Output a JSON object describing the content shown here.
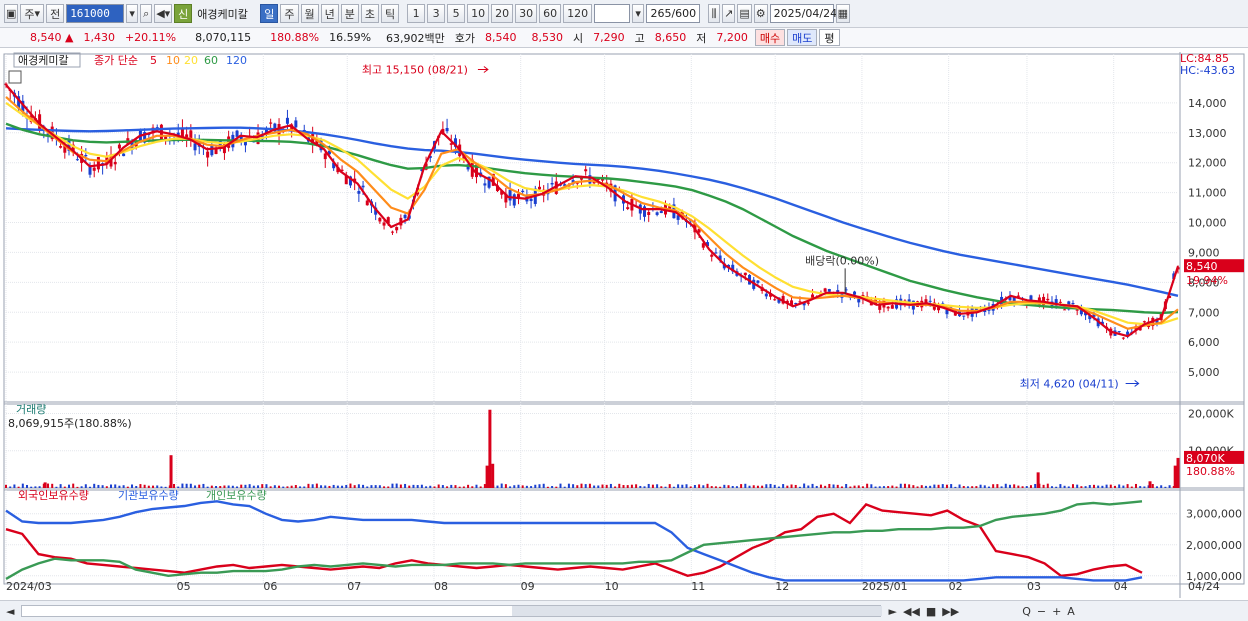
{
  "toolbar": {
    "period_label": "주",
    "prev_label": "전",
    "code": "161000",
    "badge": "신",
    "stock_name": "애경케미칼",
    "periods": [
      "일",
      "주",
      "월",
      "년",
      "분",
      "초",
      "틱"
    ],
    "active_period": "일",
    "counts": [
      "1",
      "3",
      "5",
      "10",
      "20",
      "30",
      "60",
      "120"
    ],
    "bar_count": "265",
    "bar_total": "/600",
    "date": "2025/04/24"
  },
  "quote": {
    "price": "8,540",
    "arrow": "▲",
    "change": "1,430",
    "change_pct": "+20.11%",
    "volume": "8,070,115",
    "volume_ratio": "180.88%",
    "turnover": "16.59%",
    "amount": "63,902백만",
    "hoga_label": "호가",
    "ask": "8,540",
    "bid": "8,530",
    "open_label": "시",
    "open": "7,290",
    "high_label": "고",
    "high": "8,650",
    "low_label": "저",
    "low": "7,200",
    "buy_label": "매수",
    "sell_label": "매도",
    "flat_label": "평"
  },
  "colors": {
    "up": "#d9001b",
    "down": "#1a3fcf",
    "ma5": "#d9001b",
    "ma10": "#ff8c1a",
    "ma20": "#ffe033",
    "ma60": "#2e9a45",
    "ma120": "#2a5fe0",
    "foreign": "#d9001b",
    "institution": "#2a5fe0",
    "individual": "#3a9a55"
  },
  "chart_data": [
    {
      "type": "candlestick",
      "title": "애경케미칼",
      "legend": [
        "종가 단순",
        "5",
        "10",
        "20",
        "60",
        "120"
      ],
      "series": [
        {
          "name": "5",
          "values": [
            14600,
            13950,
            13300,
            12850,
            12400,
            11880,
            11950,
            12500,
            12900,
            13050,
            12950,
            12780,
            12450,
            12500,
            12900,
            12850,
            13100,
            13250,
            12800,
            12450,
            11700,
            11300,
            10500,
            9850,
            10100,
            11900,
            13050,
            12500,
            11700,
            11400,
            10850,
            10800,
            10950,
            11250,
            11550,
            11500,
            11150,
            10700,
            10450,
            10450,
            10350,
            9900,
            9100,
            8550,
            8200,
            7850,
            7500,
            7200,
            7400,
            7650,
            7650,
            7500,
            7250,
            7300,
            7250,
            7300,
            7150,
            6950,
            7000,
            7200,
            7550,
            7400,
            7350,
            7250,
            7200,
            6800,
            6350,
            6200,
            6600,
            6800,
            8540
          ]
        },
        {
          "name": "10",
          "values": [
            14200,
            13700,
            13250,
            12800,
            12350,
            12100,
            12050,
            12400,
            12700,
            12900,
            12900,
            12800,
            12600,
            12550,
            12750,
            12900,
            13000,
            13100,
            12950,
            12600,
            12100,
            11700,
            11100,
            10500,
            10300,
            11100,
            12300,
            12450,
            12000,
            11600,
            11150,
            10900,
            10950,
            11100,
            11350,
            11400,
            11250,
            10950,
            10650,
            10500,
            10400,
            10050,
            9500,
            8950,
            8500,
            8150,
            7800,
            7500,
            7450,
            7500,
            7550,
            7480,
            7350,
            7300,
            7250,
            7250,
            7180,
            7050,
            7050,
            7150,
            7350,
            7350,
            7320,
            7250,
            7150,
            6950,
            6700,
            6450,
            6550,
            6650,
            7100
          ]
        },
        {
          "name": "20",
          "values": [
            14000,
            13600,
            13250,
            12900,
            12550,
            12300,
            12200,
            12350,
            12550,
            12700,
            12800,
            12800,
            12700,
            12650,
            12700,
            12800,
            12900,
            12950,
            12900,
            12750,
            12450,
            12100,
            11600,
            11100,
            10800,
            11200,
            11900,
            12150,
            12000,
            11750,
            11400,
            11150,
            11050,
            11100,
            11200,
            11250,
            11200,
            11050,
            10850,
            10700,
            10500,
            10200,
            9800,
            9350,
            8900,
            8500,
            8150,
            7850,
            7700,
            7600,
            7550,
            7520,
            7450,
            7380,
            7320,
            7280,
            7240,
            7180,
            7150,
            7160,
            7250,
            7300,
            7300,
            7260,
            7200,
            7050,
            6850,
            6650,
            6600,
            6620,
            6800
          ]
        },
        {
          "name": "60",
          "values": [
            13300,
            13100,
            12950,
            12850,
            12750,
            12700,
            12680,
            12700,
            12720,
            12750,
            12760,
            12770,
            12760,
            12750,
            12740,
            12730,
            12720,
            12700,
            12650,
            12550,
            12400,
            12250,
            12080,
            11920,
            11800,
            11820,
            11900,
            11920,
            11880,
            11800,
            11720,
            11650,
            11600,
            11560,
            11530,
            11500,
            11470,
            11420,
            11350,
            11280,
            11200,
            11080,
            10900,
            10700,
            10450,
            10150,
            9850,
            9550,
            9300,
            9050,
            8850,
            8650,
            8450,
            8250,
            8050,
            7900,
            7750,
            7620,
            7500,
            7400,
            7300,
            7250,
            7200,
            7160,
            7130,
            7100,
            7080,
            7040,
            7000,
            6980,
            7010
          ]
        },
        {
          "name": "120",
          "values": [
            13150,
            13120,
            13100,
            13080,
            13060,
            13050,
            13060,
            13080,
            13100,
            13120,
            13140,
            13150,
            13160,
            13170,
            13170,
            13150,
            13120,
            13080,
            13020,
            12950,
            12860,
            12760,
            12650,
            12550,
            12470,
            12420,
            12400,
            12360,
            12300,
            12230,
            12160,
            12100,
            12050,
            12000,
            11960,
            11930,
            11900,
            11860,
            11800,
            11730,
            11640,
            11540,
            11430,
            11300,
            11150,
            10980,
            10800,
            10600,
            10400,
            10200,
            10000,
            9820,
            9650,
            9480,
            9320,
            9180,
            9040,
            8920,
            8820,
            8720,
            8620,
            8520,
            8420,
            8320,
            8220,
            8120,
            8020,
            7920,
            7800,
            7680,
            7550
          ]
        }
      ],
      "annotations": [
        {
          "text": "최고 15,150 (08/21)",
          "x": "2024/08/21",
          "y": 15150
        },
        {
          "text": "최저 4,620 (04/11)",
          "x": "2025/04/11",
          "y": 4620
        },
        {
          "text": "배당락(0.00%)",
          "x": "2024/12/26",
          "y": 7600
        }
      ],
      "ylim": [
        4000,
        15500
      ],
      "yticks": [
        5000,
        6000,
        7000,
        8000,
        9000,
        10000,
        11000,
        12000,
        13000,
        14000
      ],
      "ytick_labels": [
        "5,000",
        "6,000",
        "7,000",
        "8,000",
        "9,000",
        "10,000",
        "11,000",
        "12,000",
        "13,000",
        "14,000"
      ],
      "last_price": "8,540",
      "last_pct": "19.94%",
      "lc": "LC:84.85",
      "hc": "HC:-43.63"
    },
    {
      "type": "bar",
      "title": "거래량",
      "value_label": "8,069,915주(180.88%)",
      "ylim": [
        0,
        22000
      ],
      "yticks": [
        10000,
        20000
      ],
      "ytick_labels": [
        "10,000K",
        "20,000K"
      ],
      "last_value": "8,070K",
      "last_pct": "180.88%",
      "spikes": [
        {
          "x": "2024/04/29",
          "value": 8800
        },
        {
          "x": "2024/08/21",
          "value": 21000
        },
        {
          "x": "2024/08/20",
          "value": 6000
        },
        {
          "x": "2024/08/22",
          "value": 6500
        },
        {
          "x": "2024/03/15",
          "value": 1500
        },
        {
          "x": "2025/03/05",
          "value": 4200
        },
        {
          "x": "2025/04/14",
          "value": 1800
        },
        {
          "x": "2025/04/23",
          "value": 6000
        },
        {
          "x": "2025/04/24",
          "value": 8070
        }
      ]
    },
    {
      "type": "line",
      "title": "외국인보유수량 · 기관보유수량 · 개인보유수량",
      "ylim": [
        800000,
        3700000
      ],
      "yticks": [
        1000000,
        2000000,
        3000000
      ],
      "ytick_labels": [
        "1,000,000",
        "2,000,000",
        "3,000,000"
      ],
      "series": [
        {
          "name": "외국인보유수량",
          "values": [
            2500000,
            2350000,
            1700000,
            1600000,
            1550000,
            1400000,
            1350000,
            1300000,
            1250000,
            1200000,
            1150000,
            1100000,
            1200000,
            1300000,
            1350000,
            1250000,
            1300000,
            1350000,
            1300000,
            1250000,
            1200000,
            1250000,
            1300000,
            1250000,
            1400000,
            1500000,
            1400000,
            1350000,
            1300000,
            1250000,
            1300000,
            1350000,
            1300000,
            1250000,
            1200000,
            1250000,
            1300000,
            1250000,
            1200000,
            1300000,
            1400000,
            1200000,
            1000000,
            1100000,
            1300000,
            1600000,
            1900000,
            2100000,
            2400000,
            2500000,
            2900000,
            3000000,
            2700000,
            3300000,
            3100000,
            3050000,
            3000000,
            2950000,
            3100000,
            2800000,
            2600000,
            1800000,
            1700000,
            1600000,
            1400000,
            1000000,
            1050000,
            1200000,
            1300000,
            1350000,
            1100000
          ]
        },
        {
          "name": "기관보유수량",
          "values": [
            3100000,
            2750000,
            2700000,
            2700000,
            2700000,
            2750000,
            2800000,
            2900000,
            3050000,
            3150000,
            3200000,
            3250000,
            3350000,
            3400000,
            3300000,
            3250000,
            3000000,
            2800000,
            2750000,
            2800000,
            2900000,
            2850000,
            2800000,
            2800000,
            2800000,
            2800000,
            2750000,
            2700000,
            2700000,
            2700000,
            2700000,
            2700000,
            2700000,
            2700000,
            2700000,
            2700000,
            2700000,
            2700000,
            2700000,
            2700000,
            2700000,
            2400000,
            1900000,
            1700000,
            1500000,
            1300000,
            1100000,
            950000,
            850000,
            850000,
            850000,
            850000,
            850000,
            850000,
            850000,
            850000,
            850000,
            850000,
            850000,
            850000,
            900000,
            950000,
            950000,
            950000,
            950000,
            950000,
            900000,
            850000,
            850000,
            850000,
            950000
          ]
        },
        {
          "name": "개인보유수량",
          "values": [
            900000,
            1200000,
            1400000,
            1550000,
            1500000,
            1500000,
            1500000,
            1450000,
            1200000,
            1100000,
            1000000,
            1050000,
            1100000,
            1100000,
            1150000,
            1150000,
            1150000,
            1200000,
            1300000,
            1350000,
            1300000,
            1350000,
            1400000,
            1350000,
            1300000,
            1350000,
            1350000,
            1350000,
            1400000,
            1400000,
            1400000,
            1350000,
            1400000,
            1400000,
            1400000,
            1400000,
            1400000,
            1400000,
            1400000,
            1450000,
            1450000,
            1500000,
            1750000,
            2000000,
            2050000,
            2100000,
            2150000,
            2200000,
            2250000,
            2300000,
            2350000,
            2400000,
            2400000,
            2450000,
            2450000,
            2500000,
            2500000,
            2500000,
            2550000,
            2550000,
            2600000,
            2800000,
            2900000,
            2950000,
            3000000,
            3100000,
            3300000,
            3350000,
            3300000,
            3350000,
            3400000
          ]
        }
      ]
    }
  ],
  "x_axis": {
    "labels": [
      "2024/03",
      "05",
      "06",
      "07",
      "08",
      "09",
      "10",
      "11",
      "12",
      "2025/01",
      "02",
      "03",
      "04"
    ],
    "tail_label": "04/24"
  },
  "bottom": {
    "items": [
      "◄",
      "►",
      "◀◀",
      "■",
      "▶▶",
      "Q",
      "−",
      "+",
      "A"
    ]
  }
}
